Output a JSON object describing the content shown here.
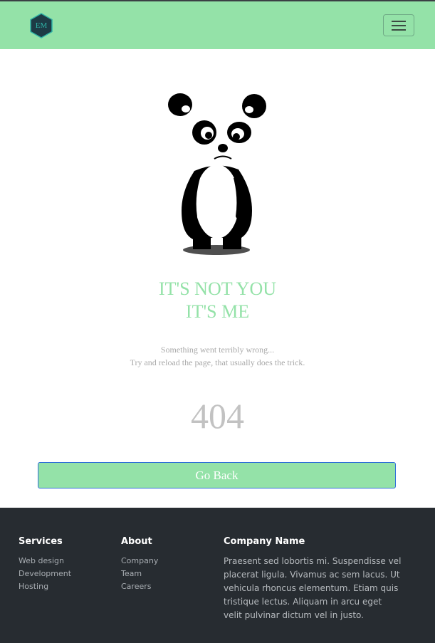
{
  "navbar": {
    "brand_initials": "EM",
    "menu_icon": "hamburger-menu-icon",
    "colors": {
      "background": "#94e2a8",
      "logo_fill": "#1d3b45",
      "logo_accent": "#2fb3a7"
    }
  },
  "error_page": {
    "illustration": "sad-panda",
    "headline_line1": "IT'S NOT YOU",
    "headline_line2": "IT'S ME",
    "message_line1": "Something went terribly wrong...",
    "message_line2": "Try and reload the page, that usually does the trick.",
    "code": "404",
    "button_label": "Go Back",
    "colors": {
      "accent": "#94e2a8",
      "muted_text": "#a9a9a9",
      "code_text": "#c2c2c2"
    }
  },
  "footer": {
    "services": {
      "heading": "Services",
      "links": [
        "Web design",
        "Development",
        "Hosting"
      ]
    },
    "about": {
      "heading": "About",
      "links": [
        "Company",
        "Team",
        "Careers"
      ]
    },
    "company": {
      "heading": "Company Name",
      "text": "Praesent sed lobortis mi. Suspendisse vel placerat ligula. Vivamus ac sem lacus. Ut vehicula rhoncus elementum. Etiam quis tristique lectus. Aliquam in arcu eget velit pulvinar dictum vel in justo."
    },
    "colors": {
      "background": "#272c31"
    }
  }
}
